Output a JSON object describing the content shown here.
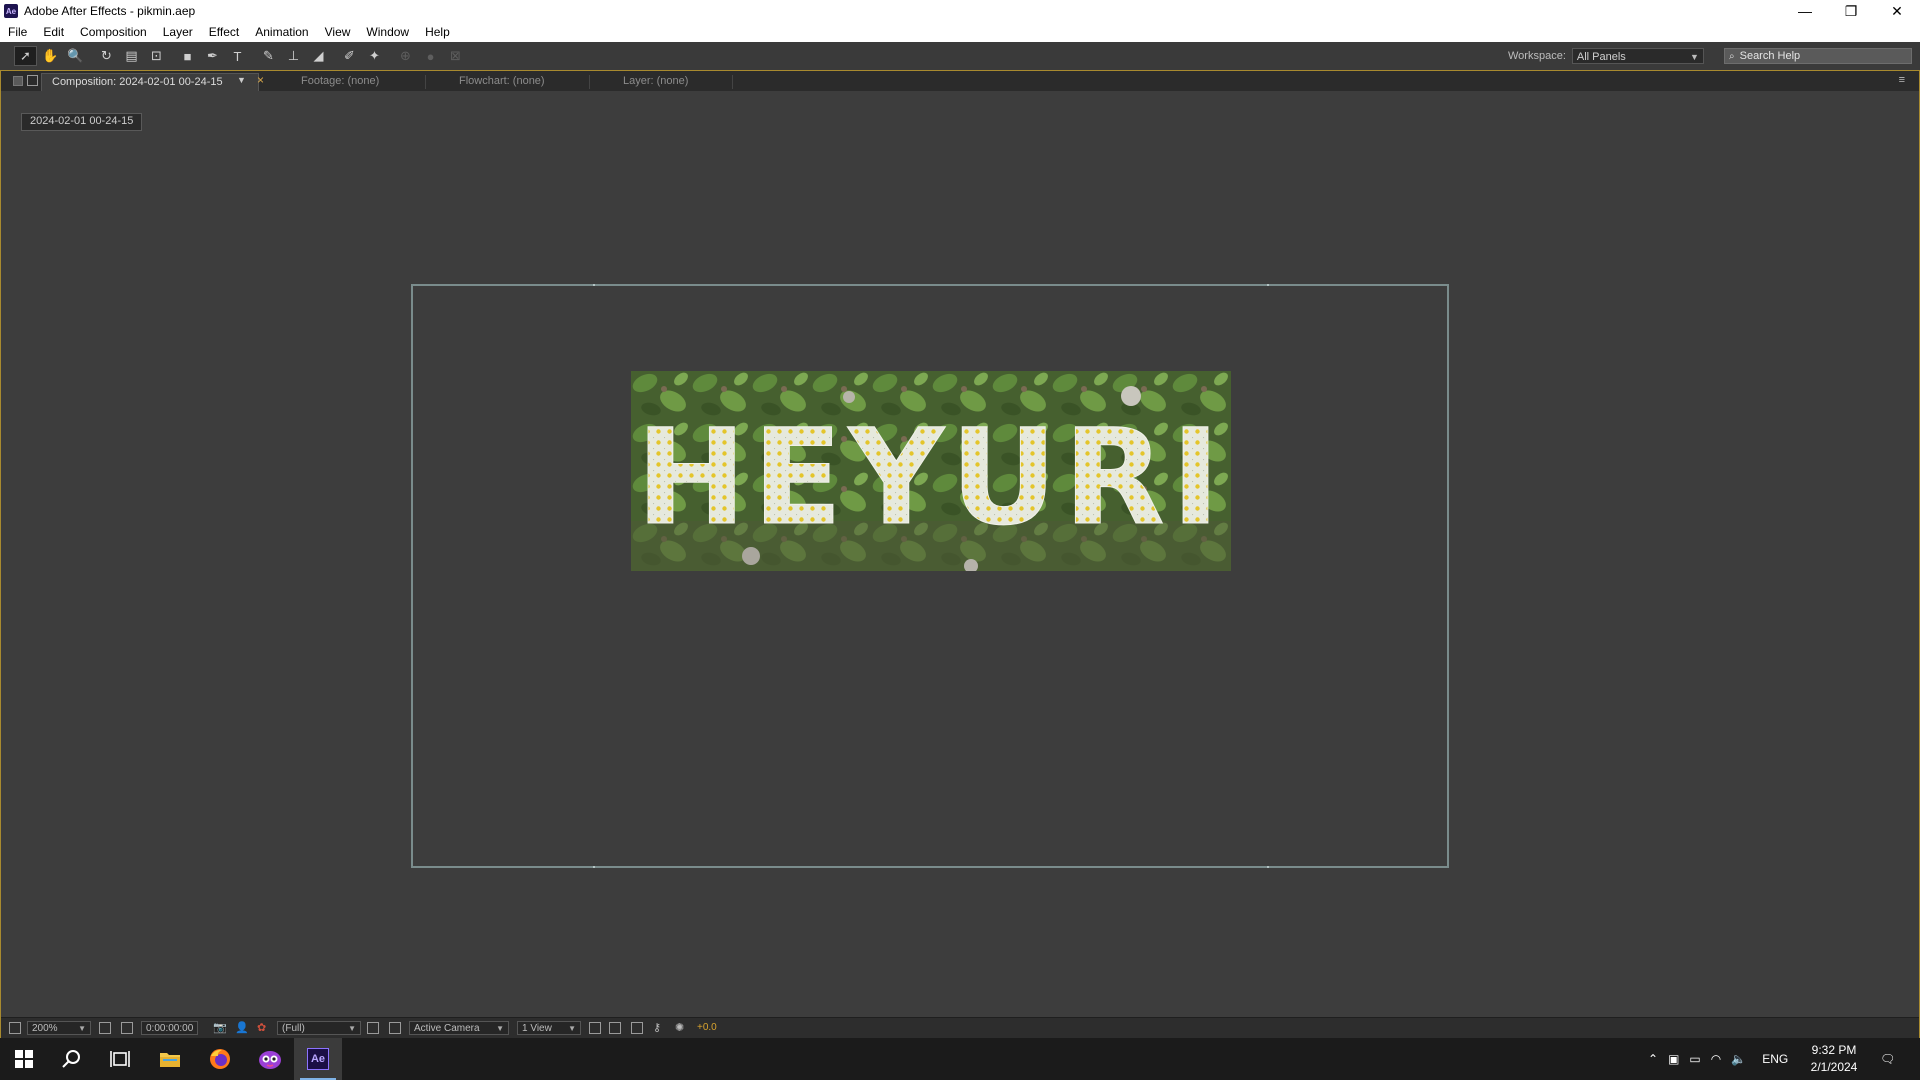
{
  "window": {
    "title": "Adobe After Effects - pikmin.aep",
    "app_icon": "Ae",
    "controls": [
      "minimize-icon",
      "restore-icon",
      "close-icon"
    ]
  },
  "menubar": {
    "items": [
      "File",
      "Edit",
      "Composition",
      "Layer",
      "Effect",
      "Animation",
      "View",
      "Window",
      "Help"
    ]
  },
  "toolbar": {
    "tools": [
      {
        "name": "selection-tool",
        "glyph": "➚",
        "active": true
      },
      {
        "name": "hand-tool",
        "glyph": "✋"
      },
      {
        "name": "zoom-tool",
        "glyph": "🔍"
      },
      {
        "name": "rotation-tool",
        "glyph": "↻"
      },
      {
        "name": "unified-camera-tool",
        "glyph": "▤"
      },
      {
        "name": "pan-behind-tool",
        "glyph": "⊡"
      },
      {
        "name": "rectangle-tool",
        "glyph": "■"
      },
      {
        "name": "pen-tool",
        "glyph": "✒"
      },
      {
        "name": "type-tool",
        "glyph": "T"
      },
      {
        "name": "brush-tool",
        "glyph": "✎"
      },
      {
        "name": "clone-stamp-tool",
        "glyph": "⊥"
      },
      {
        "name": "eraser-tool",
        "glyph": "◢"
      },
      {
        "name": "roto-brush-tool",
        "glyph": "✐"
      },
      {
        "name": "puppet-pin-tool",
        "glyph": "✦"
      },
      {
        "name": "local-axis-icon",
        "glyph": "⊕",
        "dim": true
      },
      {
        "name": "world-axis-icon",
        "glyph": "●",
        "dim": true
      },
      {
        "name": "view-axis-icon",
        "glyph": "⊠",
        "dim": true
      }
    ],
    "workspace_label": "Workspace:",
    "workspace_value": "All Panels",
    "search_placeholder": "Search Help"
  },
  "panel": {
    "tabs": [
      {
        "label": "Composition: 2024-02-01 00-24-15",
        "active": true
      },
      {
        "label": "Footage: (none)"
      },
      {
        "label": "Flowchart: (none)"
      },
      {
        "label": "Layer: (none)"
      }
    ],
    "breadcrumb": "2024-02-01 00-24-15",
    "footage_text": "HEYURI"
  },
  "viewer_bar": {
    "zoom": "200%",
    "timecode": "0:00:00:00",
    "resolution": "(Full)",
    "camera": "Active Camera",
    "views": "1 View",
    "exposure": "+0.0"
  },
  "taskbar": {
    "language": "ENG",
    "time": "9:32 PM",
    "date": "2/1/2024"
  },
  "colors": {
    "panel_highlight": "#a88a2f",
    "viewer_bg": "#3d3d3d",
    "frame": "#7a8c8c",
    "exposure": "#d8a32e"
  }
}
